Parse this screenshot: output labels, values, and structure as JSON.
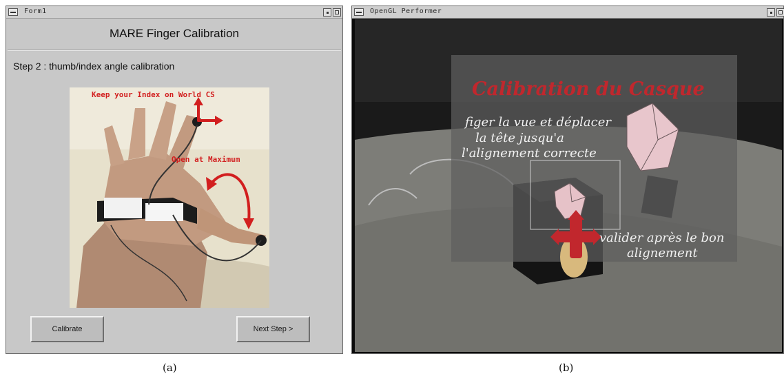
{
  "panel_a": {
    "window_title": "Form1",
    "form_title": "MARE Finger Calibration",
    "step_label": "Step 2 : thumb/index angle calibration",
    "image_overlay": {
      "instruction_1": "Keep your Index on World CS",
      "instruction_2": "Open at Maximum"
    },
    "calibrate_button": "Calibrate",
    "next_button": "Next Step >",
    "caption": "(a)"
  },
  "panel_b": {
    "window_title": "OpenGL Performer",
    "overlay_title": "Calibration du Casque",
    "instruction_lines": [
      "figer la vue et déplacer",
      "la tête jusqu'a",
      "l'alignement correcte"
    ],
    "validate_lines": [
      "valider après le bon",
      "alignement"
    ],
    "caption": "(b)"
  },
  "colors": {
    "overlay_red": "#d21f1f",
    "title_red": "#c1272d",
    "window_gray": "#c8c8c8"
  }
}
